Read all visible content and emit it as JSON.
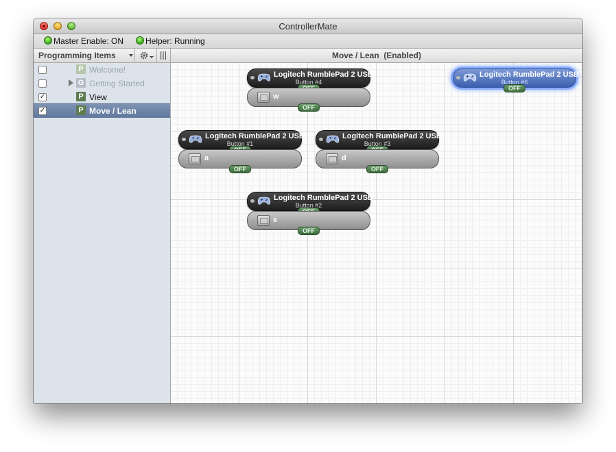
{
  "window": {
    "title": "ControllerMate"
  },
  "status": {
    "master": "Master Enable: ON",
    "helper": "Helper: Running"
  },
  "sidebar": {
    "header": "Programming Items",
    "items": [
      {
        "label": "Welcome!",
        "badge": "P",
        "checked": false
      },
      {
        "label": "Getting Started",
        "badge": "G",
        "checked": false
      },
      {
        "label": "View",
        "badge": "P",
        "checked": true
      },
      {
        "label": "Move / Lean",
        "badge": "P",
        "checked": true
      }
    ]
  },
  "canvas": {
    "header": "Move / Lean  (Enabled)"
  },
  "nodes": [
    {
      "title": "Logitech RumblePad 2 USB",
      "sub": "Button #4",
      "state": "OFF",
      "key": "w",
      "out": "OFF"
    },
    {
      "title": "Logitech RumblePad 2 USB",
      "sub": "Button #6",
      "state": "OFF"
    },
    {
      "title": "Logitech RumblePad 2 USB",
      "sub": "Button #1",
      "state": "OFF",
      "key": "a",
      "out": "OFF"
    },
    {
      "title": "Logitech RumblePad 2 USB",
      "sub": "Button #3",
      "state": "OFF",
      "key": "d",
      "out": "OFF"
    },
    {
      "title": "Logitech RumblePad 2 USB",
      "sub": "Button #2",
      "state": "OFF",
      "key": "s",
      "out": "OFF"
    }
  ],
  "colors": {
    "selection": "#6a80a4",
    "led": "#27a30f",
    "off_badge": "#4f7f4f",
    "node_selected": "#4a6fc4"
  },
  "icons": {
    "controller": "gamepad-icon",
    "keyboard": "keyboard-key-icon",
    "gear": "gear-icon",
    "columns": "columns-icon"
  }
}
